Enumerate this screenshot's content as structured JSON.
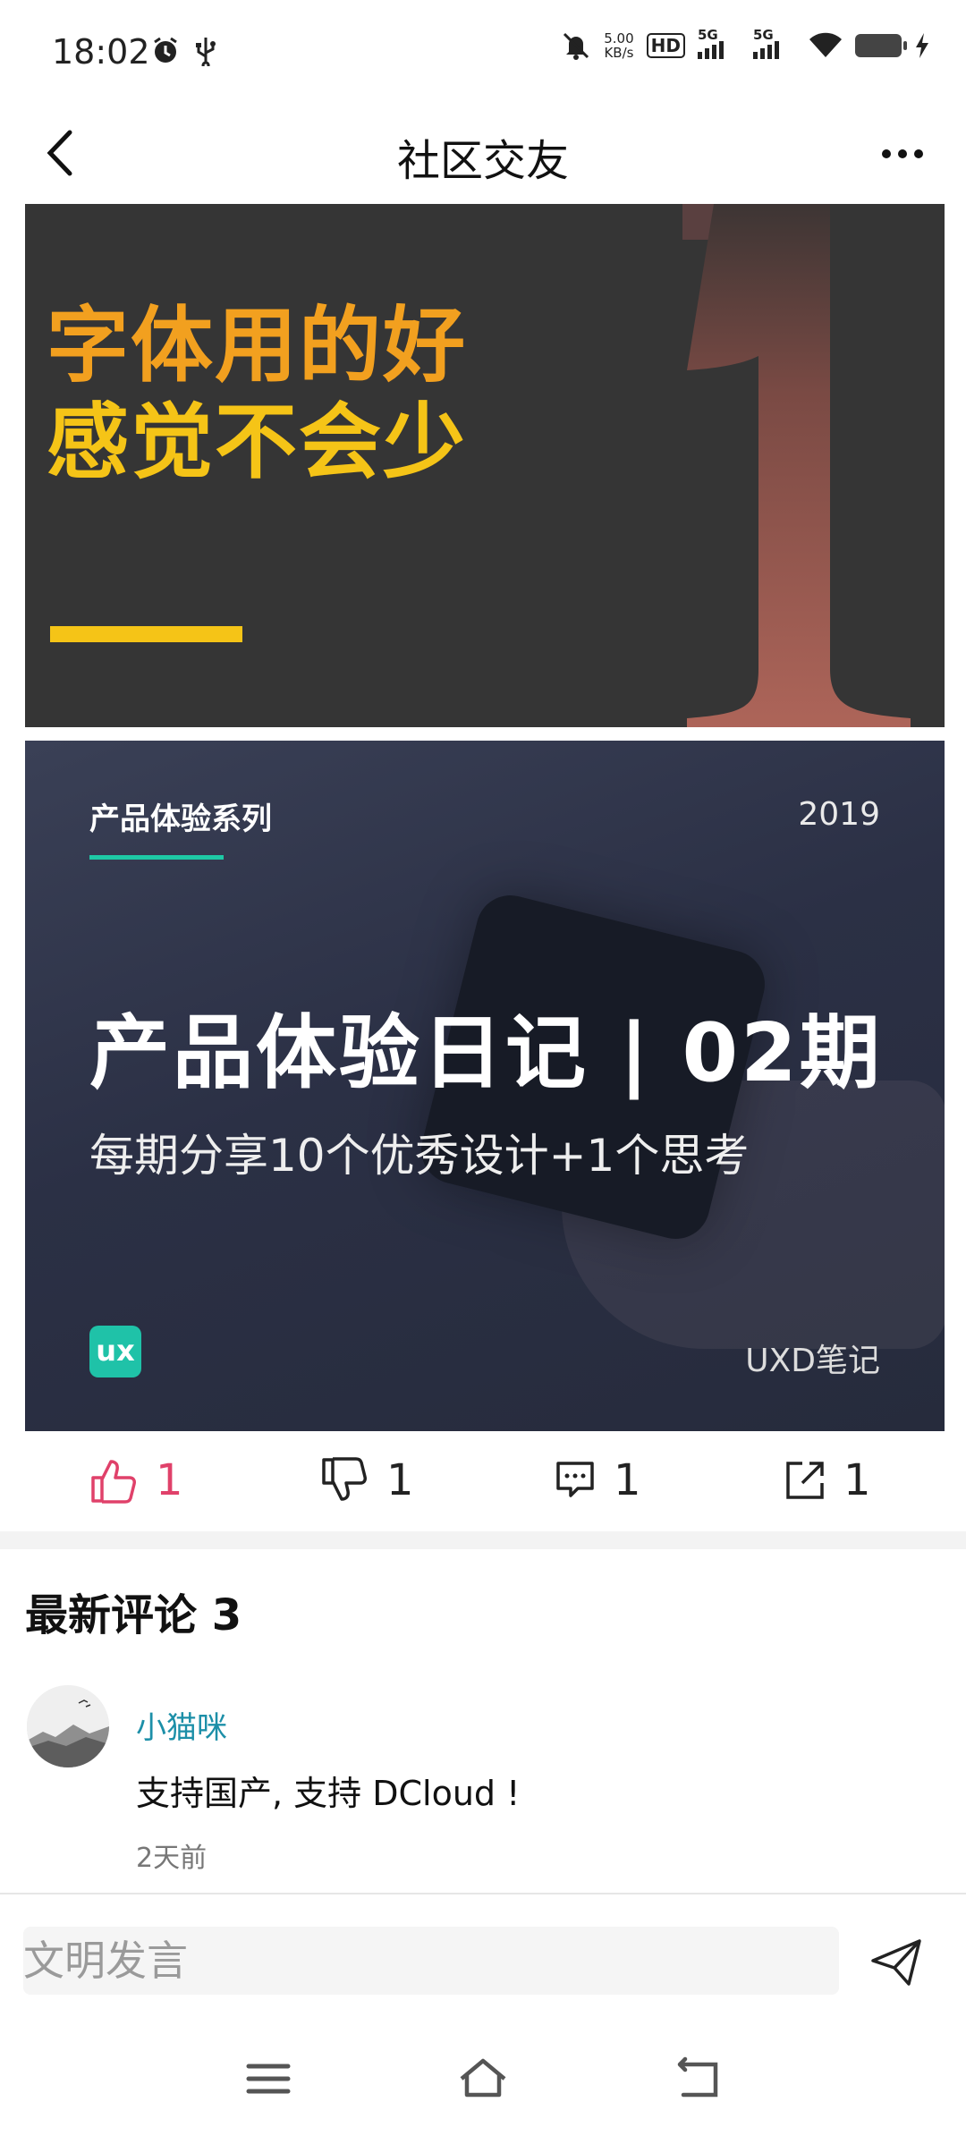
{
  "status_bar": {
    "time": "18:02",
    "net_speed_value": "5.00",
    "net_speed_unit": "KB/s",
    "hd_label": "HD",
    "sim1_label": "5G",
    "sim2_label": "5G",
    "icons": [
      "alarm-icon",
      "usb-icon",
      "mute-icon",
      "hd-icon",
      "signal-5g-icon",
      "signal-5g-icon",
      "wifi-icon",
      "battery-icon",
      "charging-icon"
    ]
  },
  "navbar": {
    "title": "社区交友",
    "back_icon": "chevron-left-icon",
    "more_icon": "more-horizontal-icon"
  },
  "post_images": [
    {
      "line1": "字体用的好",
      "line2": "感觉不会少"
    },
    {
      "series": "产品体验系列",
      "year": "2019",
      "headline": "产品体验日记 | 02期",
      "subtitle": "每期分享10个优秀设计+1个思考",
      "logo_text": "ux",
      "brand": "UXD笔记"
    }
  ],
  "actions": {
    "like_count": "1",
    "dislike_count": "1",
    "comment_count": "1",
    "share_count": "1",
    "like_color": "#e0416a"
  },
  "comments": {
    "title": "最新评论 3",
    "items": [
      {
        "user": "小猫咪",
        "text": "支持国产, 支持 DCloud !",
        "time": "2天前"
      }
    ]
  },
  "input": {
    "placeholder": "文明发言",
    "send_icon": "send-icon"
  },
  "system_nav": [
    "menu-icon",
    "home-icon",
    "back-icon"
  ]
}
